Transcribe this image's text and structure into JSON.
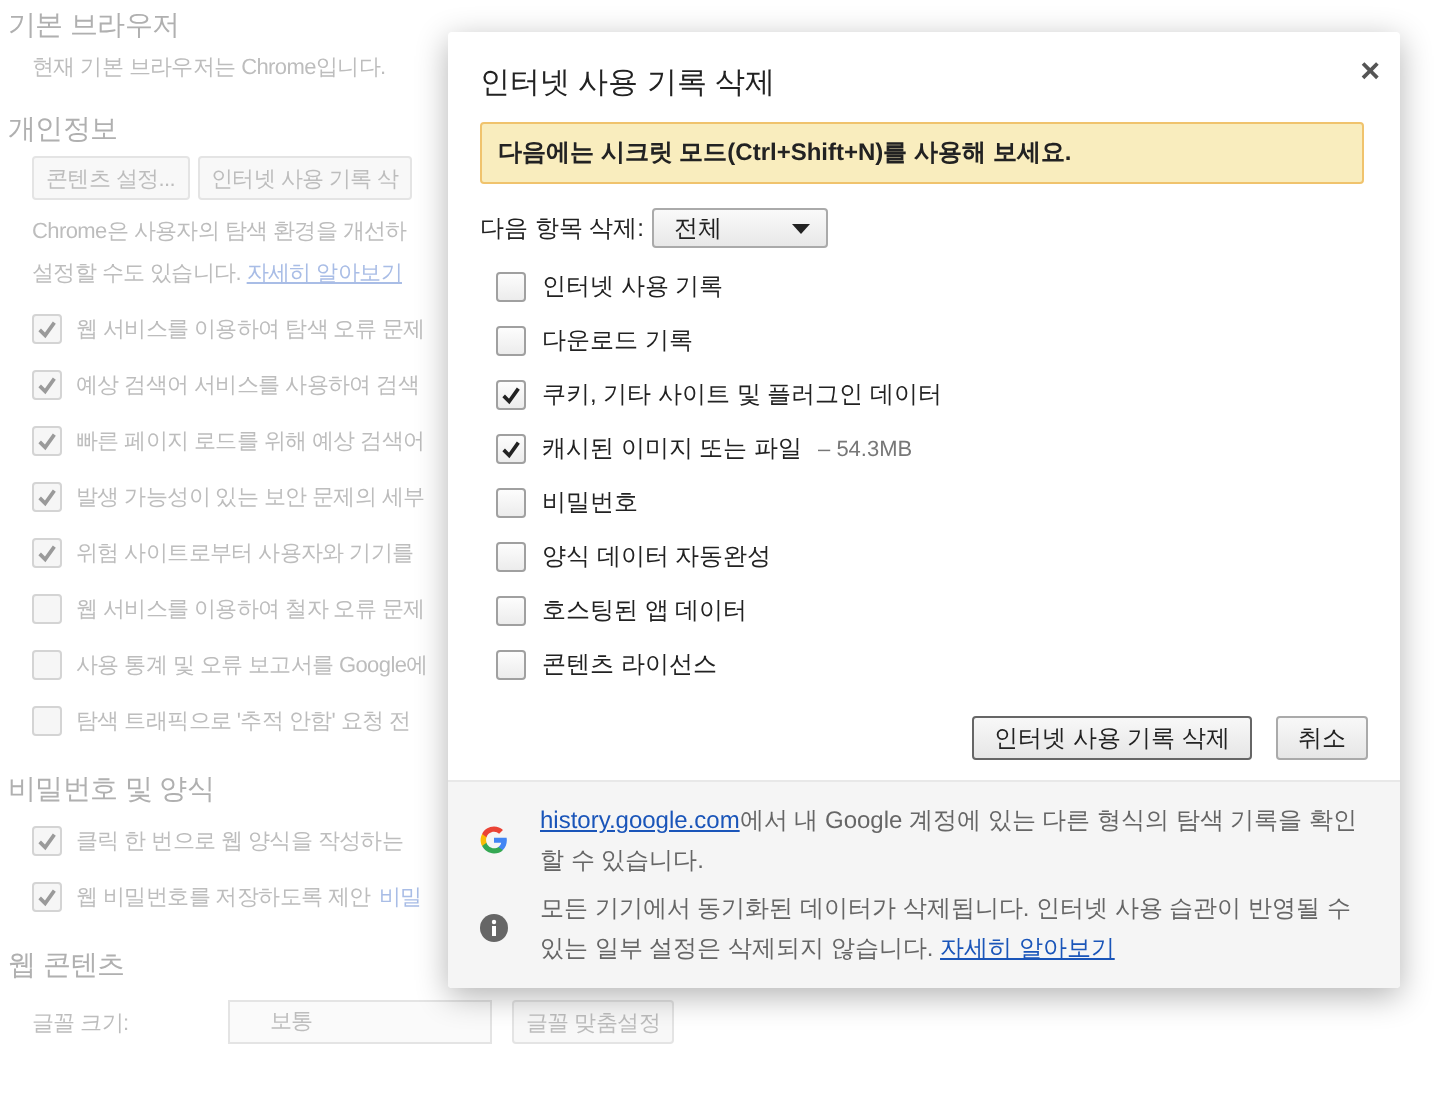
{
  "settings_page": [
    {
      "kind": "heading",
      "text": "기본 브라우저"
    },
    {
      "kind": "text",
      "text": "현재 기본 브라우저는 Chrome입니다."
    },
    {
      "kind": "heading",
      "text": "개인정보"
    },
    {
      "kind": "buttons",
      "buttons": [
        "콘텐츠 설정...",
        "인터넷 사용 기록 삭"
      ]
    },
    {
      "kind": "paragraph",
      "line_1": "Chrome은 사용자의 탐색 환경을 개선하",
      "line_2": "설정할 수도 있습니다.",
      "link": "자세히 알아보기"
    },
    {
      "kind": "checkbox",
      "label": "웹 서비스를 이용하여 탐색 오류 문제",
      "checked": true
    },
    {
      "kind": "checkbox",
      "label": "예상 검색어 서비스를 사용하여 검색",
      "checked": true
    },
    {
      "kind": "checkbox",
      "label": "빠른 페이지 로드를 위해 예상 검색어",
      "checked": true
    },
    {
      "kind": "checkbox",
      "label": "발생 가능성이 있는 보안 문제의 세부",
      "checked": true
    },
    {
      "kind": "checkbox",
      "label": "위험 사이트로부터 사용자와 기기를",
      "checked": true
    },
    {
      "kind": "checkbox",
      "label": "웹 서비스를 이용하여 철자 오류 문제",
      "checked": false
    },
    {
      "kind": "checkbox",
      "label": "사용 통계 및 오류 보고서를 Google에",
      "checked": false
    },
    {
      "kind": "checkbox",
      "label": "탐색 트래픽으로 '추적 안함' 요청 전",
      "checked": false
    },
    {
      "kind": "heading",
      "text": "비밀번호 및 양식"
    },
    {
      "kind": "checkbox",
      "label": "클릭 한 번으로 웹 양식을 작성하는",
      "checked": true
    },
    {
      "kind": "checkbox",
      "label": "웹 비밀번호를 저장하도록 제안",
      "checked": true,
      "link": "비밀"
    },
    {
      "kind": "heading",
      "text": "웹 콘텐츠"
    },
    {
      "kind": "font_row",
      "label": "글꼴 크기:",
      "select": "보통",
      "button": "글꼴 맞춤설정"
    }
  ],
  "dialog": {
    "title": "인터넷 사용 기록 삭제",
    "close": "×",
    "banner": "다음에는 시크릿 모드(Ctrl+Shift+N)를 사용해 보세요.",
    "range_label": "다음 항목 삭제:",
    "range_value": "전체",
    "items": [
      {
        "label": "인터넷 사용 기록",
        "checked": false
      },
      {
        "label": "다운로드 기록",
        "checked": false
      },
      {
        "label": "쿠키, 기타 사이트 및 플러그인 데이터",
        "checked": true
      },
      {
        "label": "캐시된 이미지 또는 파일",
        "checked": true,
        "size": "– 54.3MB"
      },
      {
        "label": "비밀번호",
        "checked": false
      },
      {
        "label": "양식 데이터 자동완성",
        "checked": false
      },
      {
        "label": "호스팅된 앱 데이터",
        "checked": false
      },
      {
        "label": "콘텐츠 라이선스",
        "checked": false
      }
    ],
    "buttons": [
      "인터넷 사용 기록 삭제",
      "취소"
    ],
    "footer": [
      {
        "kind": "google",
        "link": "history.google.com",
        "text": "에서 내 Google 계정에 있는 다른 형식의 탐색 기록을 확인할 수 있습니다."
      },
      {
        "kind": "info",
        "text": "모든 기기에서 동기화된 데이터가 삭제됩니다. 인터넷 사용 습관이 반영될 수 있는 일부 설정은 삭제되지 않습니다. ",
        "link": "자세히 알아보기"
      }
    ]
  }
}
